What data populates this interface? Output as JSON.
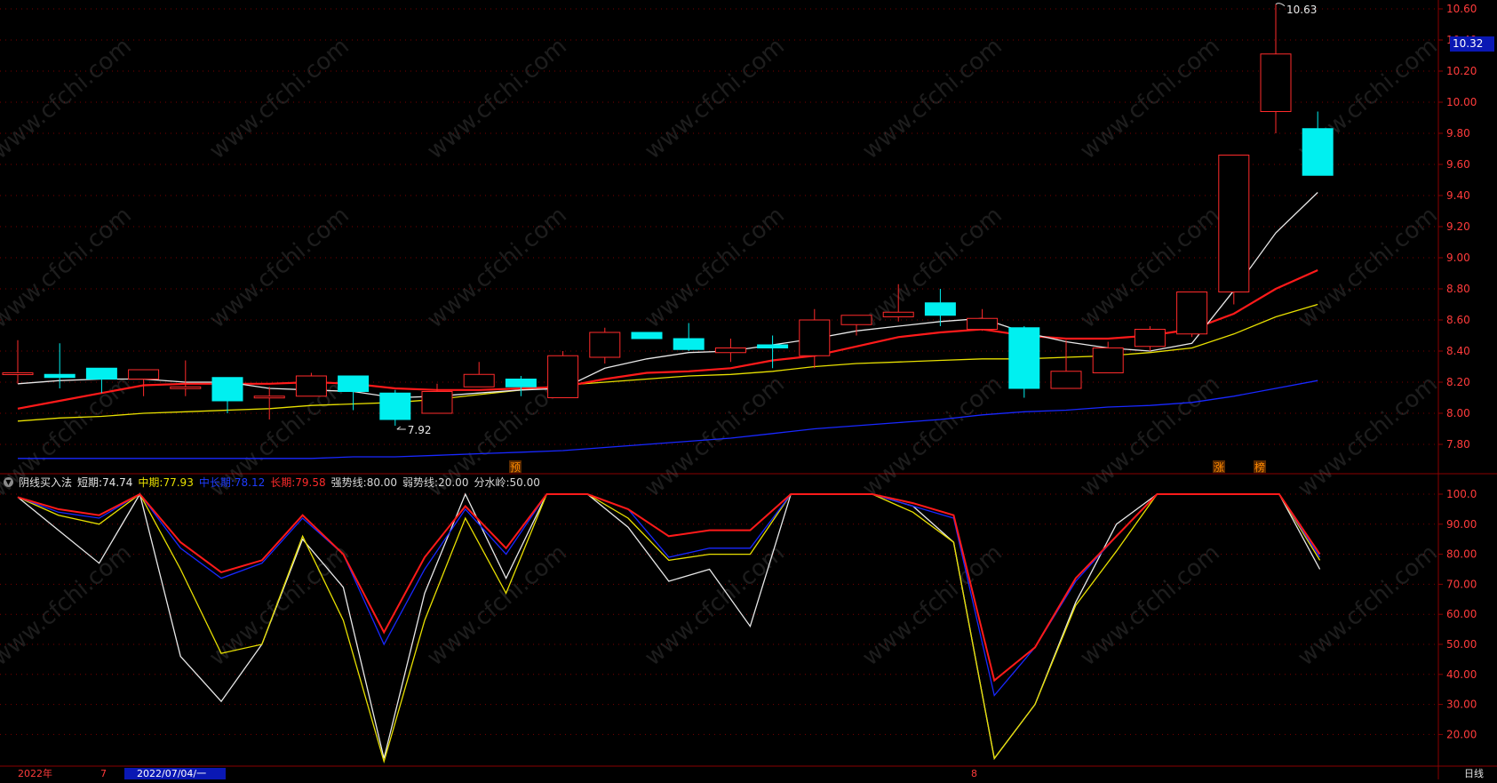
{
  "watermark": "www.cfchi.com",
  "colors": {
    "background": "#000000",
    "grid": "#7a0000",
    "up": "#ff2b2b",
    "down": "#00f0f0",
    "ma_white": "#e8e8e8",
    "ma_red": "#ff1a1a",
    "ma_yellow": "#e8e000",
    "ma_blue": "#1828ff",
    "axis_text": "#ff3b3b"
  },
  "price_axis": {
    "ticks": [
      "10.60",
      "10.40",
      "10.20",
      "10.00",
      "9.80",
      "9.60",
      "9.40",
      "9.20",
      "9.00",
      "8.80",
      "8.60",
      "8.40",
      "8.20",
      "8.00",
      "7.80"
    ],
    "current_price": "10.32"
  },
  "osc_axis": {
    "ticks": [
      "100.0",
      "90.00",
      "80.00",
      "70.00",
      "60.00",
      "50.00",
      "40.00",
      "30.00",
      "20.00"
    ]
  },
  "annotations": {
    "high_label": "10.63",
    "low_label": "7.92",
    "marker_yu": "预",
    "marker_zhang": "涨",
    "marker_bang": "榜"
  },
  "indicator": {
    "name": "阴线买入法",
    "short_label": "短期:",
    "short_value": "74.74",
    "mid_label": "中期:",
    "mid_value": "77.93",
    "midlong_label": "中长期:",
    "midlong_value": "78.12",
    "long_label": "长期:",
    "long_value": "79.58",
    "strong_label": "强势线:",
    "strong_value": "80.00",
    "weak_label": "弱势线:",
    "weak_value": "20.00",
    "water_label": "分水岭:",
    "water_value": "50.00"
  },
  "footer": {
    "year": "2022年",
    "month7": "7",
    "cursor_date": "2022/07/04/一",
    "month8": "8",
    "period": "日线"
  },
  "chart_data": [
    {
      "type": "candlestick",
      "ylim": [
        7.7,
        10.65
      ],
      "candles": [
        {
          "o": 8.25,
          "h": 8.47,
          "l": 8.19,
          "c": 8.26
        },
        {
          "o": 8.25,
          "h": 8.45,
          "l": 8.16,
          "c": 8.23
        },
        {
          "o": 8.29,
          "h": 8.29,
          "l": 8.13,
          "c": 8.22
        },
        {
          "o": 8.22,
          "h": 8.28,
          "l": 8.11,
          "c": 8.28
        },
        {
          "o": 8.17,
          "h": 8.34,
          "l": 8.11,
          "c": 8.17
        },
        {
          "o": 8.23,
          "h": 8.23,
          "l": 8.0,
          "c": 8.08
        },
        {
          "o": 8.1,
          "h": 8.17,
          "l": 7.96,
          "c": 8.11
        },
        {
          "o": 8.11,
          "h": 8.26,
          "l": 8.11,
          "c": 8.24
        },
        {
          "o": 8.24,
          "h": 8.24,
          "l": 8.02,
          "c": 8.14
        },
        {
          "o": 8.13,
          "h": 8.15,
          "l": 7.92,
          "c": 7.96
        },
        {
          "o": 8.0,
          "h": 8.19,
          "l": 8.0,
          "c": 8.14
        },
        {
          "o": 8.17,
          "h": 8.33,
          "l": 8.17,
          "c": 8.25
        },
        {
          "o": 8.22,
          "h": 8.24,
          "l": 8.11,
          "c": 8.17
        },
        {
          "o": 8.1,
          "h": 8.4,
          "l": 8.1,
          "c": 8.37
        },
        {
          "o": 8.36,
          "h": 8.55,
          "l": 8.32,
          "c": 8.52
        },
        {
          "o": 8.52,
          "h": 8.52,
          "l": 8.48,
          "c": 8.48
        },
        {
          "o": 8.48,
          "h": 8.58,
          "l": 8.4,
          "c": 8.41
        },
        {
          "o": 8.39,
          "h": 8.48,
          "l": 8.33,
          "c": 8.42
        },
        {
          "o": 8.44,
          "h": 8.5,
          "l": 8.29,
          "c": 8.42
        },
        {
          "o": 8.37,
          "h": 8.67,
          "l": 8.29,
          "c": 8.6
        },
        {
          "o": 8.57,
          "h": 8.63,
          "l": 8.5,
          "c": 8.63
        },
        {
          "o": 8.62,
          "h": 8.83,
          "l": 8.59,
          "c": 8.65
        },
        {
          "o": 8.71,
          "h": 8.8,
          "l": 8.56,
          "c": 8.63
        },
        {
          "o": 8.54,
          "h": 8.67,
          "l": 8.53,
          "c": 8.61
        },
        {
          "o": 8.55,
          "h": 8.56,
          "l": 8.1,
          "c": 8.16
        },
        {
          "o": 8.16,
          "h": 8.47,
          "l": 8.16,
          "c": 8.27
        },
        {
          "o": 8.26,
          "h": 8.46,
          "l": 8.26,
          "c": 8.42
        },
        {
          "o": 8.43,
          "h": 8.56,
          "l": 8.4,
          "c": 8.54
        },
        {
          "o": 8.51,
          "h": 8.78,
          "l": 8.49,
          "c": 8.78
        },
        {
          "o": 8.78,
          "h": 9.66,
          "l": 8.7,
          "c": 9.66
        },
        {
          "o": 9.94,
          "h": 10.63,
          "l": 9.8,
          "c": 10.31
        },
        {
          "o": 9.83,
          "h": 9.94,
          "l": 9.53,
          "c": 9.53
        }
      ],
      "ma_white": [
        8.19,
        8.21,
        8.22,
        8.22,
        8.2,
        8.2,
        8.16,
        8.15,
        8.14,
        8.1,
        8.11,
        8.13,
        8.15,
        8.16,
        8.29,
        8.35,
        8.39,
        8.4,
        8.44,
        8.48,
        8.53,
        8.56,
        8.59,
        8.61,
        8.52,
        8.46,
        8.42,
        8.4,
        8.45,
        8.79,
        9.16,
        9.42
      ],
      "ma_red": [
        8.03,
        8.08,
        8.13,
        8.18,
        8.19,
        8.19,
        8.19,
        8.2,
        8.19,
        8.16,
        8.15,
        8.15,
        8.16,
        8.17,
        8.22,
        8.26,
        8.27,
        8.29,
        8.34,
        8.37,
        8.43,
        8.49,
        8.52,
        8.54,
        8.5,
        8.48,
        8.48,
        8.5,
        8.54,
        8.64,
        8.8,
        8.92
      ],
      "ma_yellow": [
        7.95,
        7.97,
        7.98,
        8.0,
        8.01,
        8.02,
        8.03,
        8.05,
        8.06,
        8.07,
        8.09,
        8.12,
        8.15,
        8.18,
        8.2,
        8.22,
        8.24,
        8.25,
        8.27,
        8.3,
        8.32,
        8.33,
        8.34,
        8.35,
        8.35,
        8.36,
        8.37,
        8.39,
        8.42,
        8.51,
        8.62,
        8.7
      ],
      "ma_blue": [
        7.71,
        7.71,
        7.71,
        7.71,
        7.71,
        7.71,
        7.71,
        7.71,
        7.72,
        7.72,
        7.73,
        7.74,
        7.75,
        7.76,
        7.78,
        7.8,
        7.82,
        7.84,
        7.87,
        7.9,
        7.92,
        7.94,
        7.96,
        7.99,
        8.01,
        8.02,
        8.04,
        8.05,
        8.07,
        8.11,
        8.16,
        8.21
      ]
    },
    {
      "type": "line",
      "title": "阴线买入法",
      "ylim": [
        10,
        102
      ],
      "series": [
        {
          "name": "短期",
          "color": "#e8e8e8",
          "values": [
            99,
            88,
            77,
            100,
            46,
            31,
            50,
            85,
            69,
            12,
            67,
            100,
            72,
            100,
            100,
            89,
            71,
            75,
            56,
            100,
            100,
            100,
            96,
            84,
            12,
            30,
            64,
            90,
            100,
            100,
            100,
            100,
            75
          ]
        },
        {
          "name": "中期",
          "color": "#e8e000",
          "values": [
            99,
            93,
            90,
            100,
            75,
            47,
            50,
            86,
            58,
            11,
            58,
            92,
            67,
            100,
            100,
            92,
            78,
            80,
            80,
            100,
            100,
            100,
            94,
            84,
            12,
            30,
            63,
            81,
            100,
            100,
            100,
            100,
            78
          ]
        },
        {
          "name": "中长期",
          "color": "#1828ff",
          "values": [
            99,
            94,
            92,
            100,
            82,
            72,
            77,
            92,
            80,
            50,
            75,
            95,
            80,
            100,
            100,
            95,
            79,
            82,
            82,
            100,
            100,
            100,
            96,
            92,
            33,
            49,
            71,
            86,
            100,
            100,
            100,
            100,
            79
          ]
        },
        {
          "name": "长期",
          "color": "#ff1a1a",
          "values": [
            99,
            95,
            93,
            100,
            84,
            74,
            78,
            93,
            80,
            54,
            79,
            96,
            82,
            100,
            100,
            95,
            86,
            88,
            88,
            100,
            100,
            100,
            97,
            93,
            38,
            49,
            72,
            86,
            100,
            100,
            100,
            100,
            80
          ]
        }
      ]
    }
  ]
}
